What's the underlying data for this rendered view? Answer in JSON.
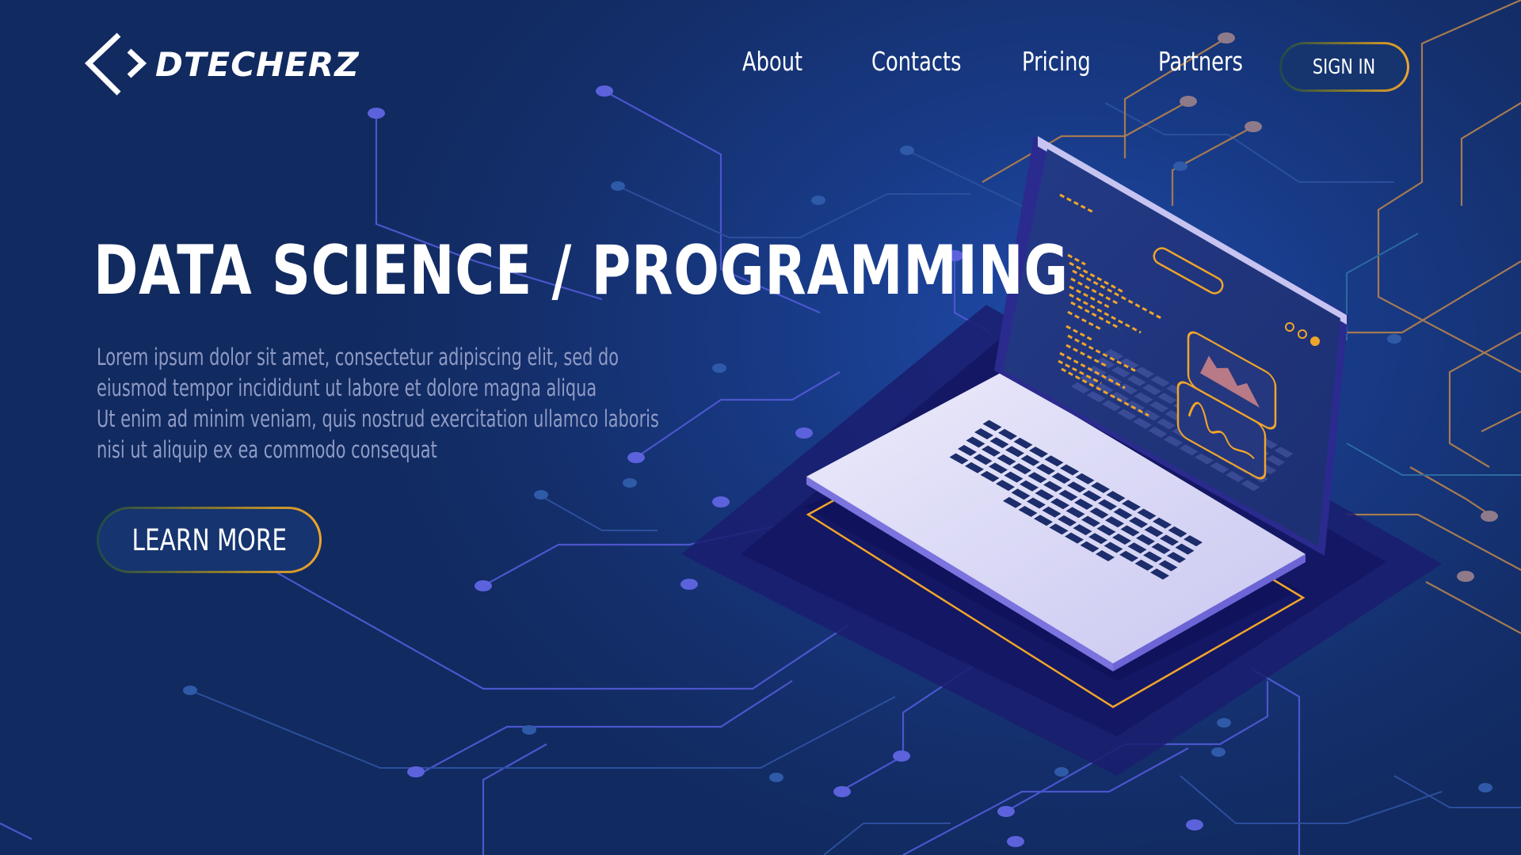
{
  "brand": {
    "name": "DTECHERZ"
  },
  "nav": {
    "items": [
      {
        "label": "About"
      },
      {
        "label": "Contacts"
      },
      {
        "label": "Pricing"
      },
      {
        "label": "Partners"
      }
    ],
    "sign_in_label": "SIGN IN"
  },
  "hero": {
    "title": "DATA SCIENCE / PROGRAMMING",
    "body_lines": [
      "Lorem ipsum dolor sit amet, consectetur adipiscing elit, sed do",
      "eiusmod tempor incididunt ut labore et dolore magna aliqua",
      "Ut enim ad minim veniam, quis nostrud exercitation ullamco laboris",
      "nisi ut aliquip ex ea commodo consequat"
    ],
    "cta_label": "LEARN MORE"
  },
  "colors": {
    "background": "#17326f",
    "circuit_line": "#5a5fd8",
    "accent_orange": "#f0a52a",
    "laptop_body": "#d9d8f6",
    "screen": "#23367e",
    "body_text": "#8f9bc4"
  },
  "icons": [
    "logo-chevrons-icon",
    "line-chart-icon",
    "area-chart-icon",
    "window-dots-icon"
  ]
}
